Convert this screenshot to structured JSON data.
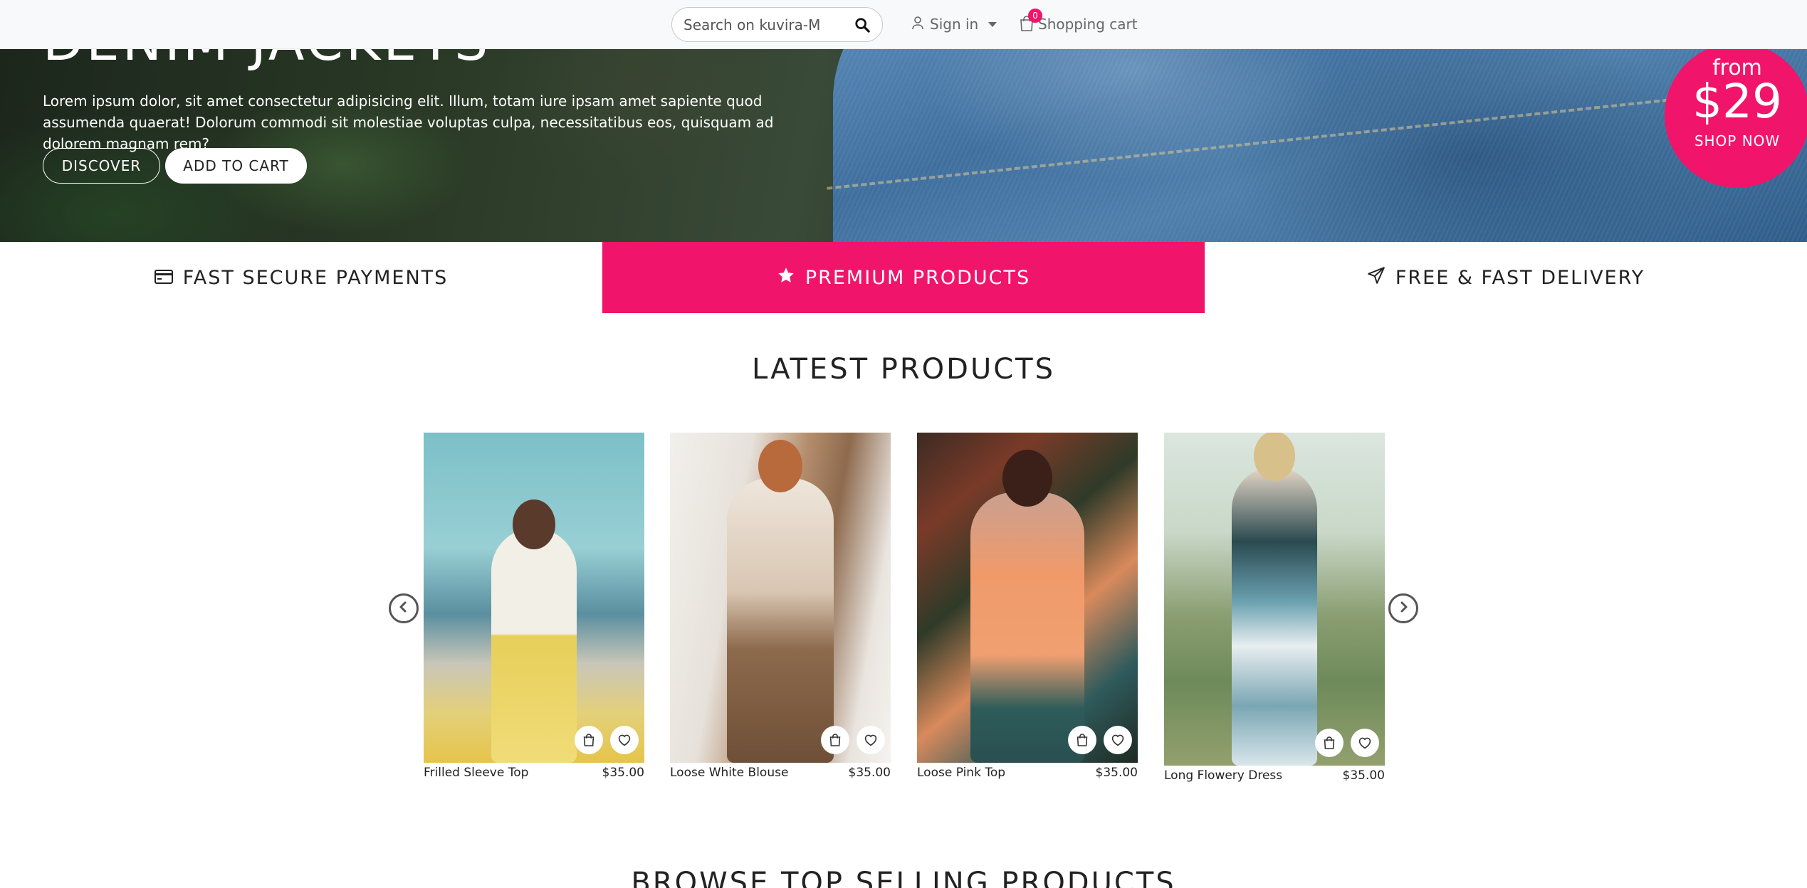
{
  "nav": {
    "search_placeholder": "Search on kuvira-M",
    "signin_label": "Sign in",
    "cart_label": "Shopping cart",
    "cart_count": "0"
  },
  "hero": {
    "title": "DENIM JACKETS",
    "text": "Lorem ipsum dolor, sit amet consectetur adipisicing elit. Illum, totam iure ipsam amet sapiente quod assumenda quaerat! Dolorum commodi sit molestiae voluptas culpa, necessitatibus eos, quisquam ad dolorem magnam rem?",
    "discover_label": "DISCOVER",
    "add_to_cart_label": "ADD TO CART"
  },
  "promo": {
    "from": "from",
    "price": "$29",
    "shop_now": "SHOP NOW"
  },
  "features": [
    {
      "label": "FAST SECURE PAYMENTS",
      "icon": "credit-card-icon"
    },
    {
      "label": "PREMIUM PRODUCTS",
      "icon": "star-icon"
    },
    {
      "label": "FREE & FAST DELIVERY",
      "icon": "paper-plane-icon"
    }
  ],
  "latest": {
    "title": "LATEST PRODUCTS",
    "products": [
      {
        "name": "Frilled Sleeve Top",
        "price": "$35.00"
      },
      {
        "name": "Loose White Blouse",
        "price": "$35.00"
      },
      {
        "name": "Loose Pink Top",
        "price": "$35.00"
      },
      {
        "name": "Long Flowery Dress",
        "price": "$35.00"
      }
    ]
  },
  "browse": {
    "title": "BROWSE TOP SELLING PRODUCTS"
  },
  "colors": {
    "accent": "#f0156a",
    "nav_bg": "#f8f9fa"
  }
}
